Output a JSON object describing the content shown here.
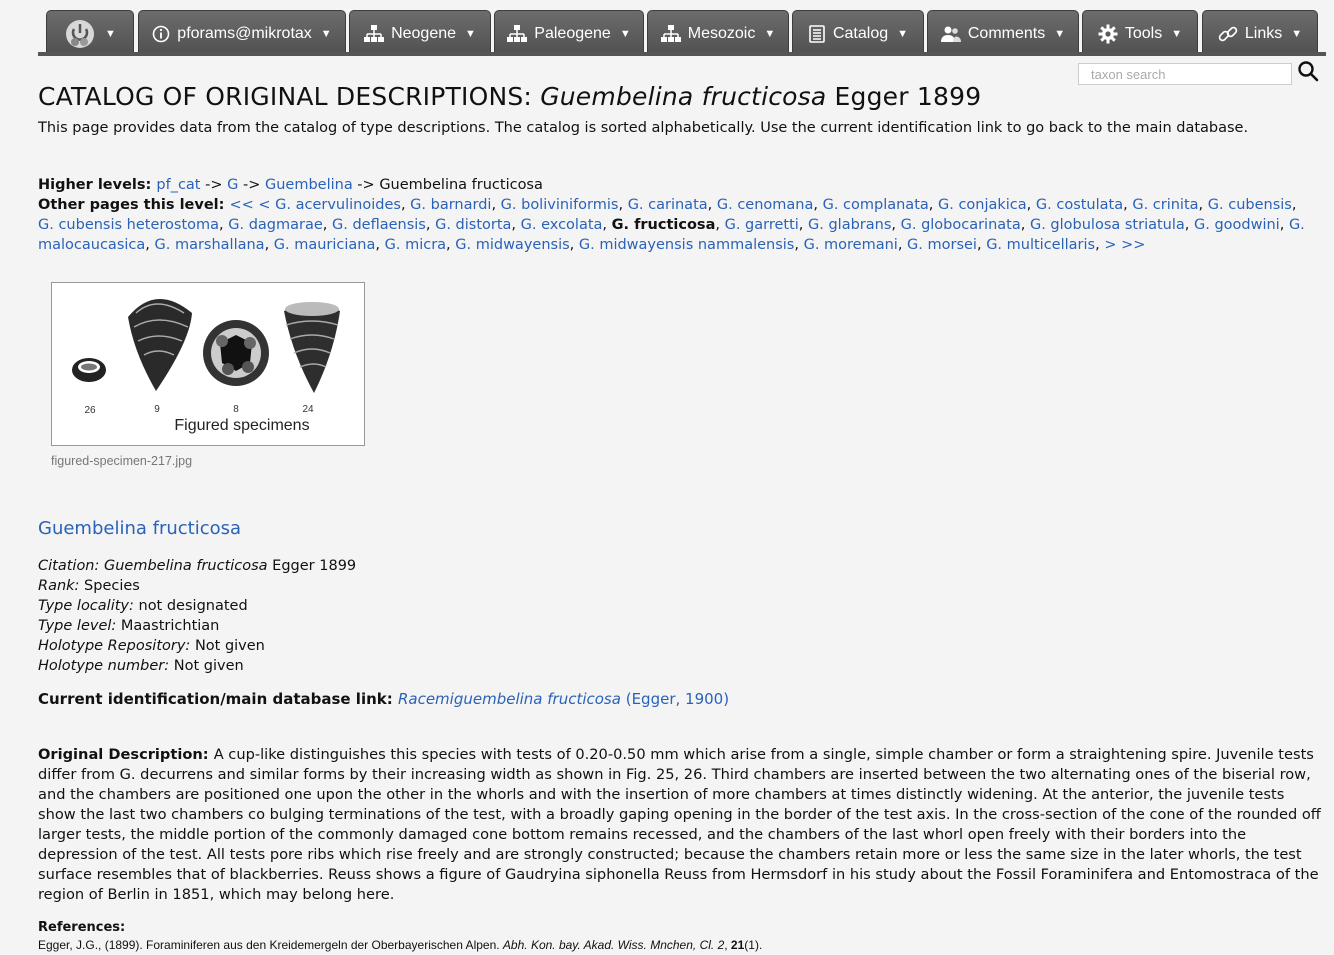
{
  "nav": {
    "tabs": [
      {
        "label": "",
        "icon": "logo-icon"
      },
      {
        "label": "pforams@mikrotax",
        "icon": "info-icon"
      },
      {
        "label": "Neogene",
        "icon": "hierarchy-icon"
      },
      {
        "label": "Paleogene",
        "icon": "hierarchy-icon"
      },
      {
        "label": "Mesozoic",
        "icon": "hierarchy-icon"
      },
      {
        "label": "Catalog",
        "icon": "book-icon"
      },
      {
        "label": "Comments",
        "icon": "users-icon"
      },
      {
        "label": "Tools",
        "icon": "gear-icon"
      },
      {
        "label": "Links",
        "icon": "link-icon"
      }
    ]
  },
  "search": {
    "placeholder": "taxon search"
  },
  "page": {
    "title_prefix": "CATALOG OF ORIGINAL DESCRIPTIONS: ",
    "title_taxon": "Guembelina fructicosa",
    "title_author": " Egger 1899",
    "intro": "This page provides data from the catalog of type descriptions. The catalog is sorted alphabetically. Use the current identification link to go back to the main database."
  },
  "higher_levels": {
    "label": "Higher levels: ",
    "path": [
      "pf_cat",
      "G",
      "Guembelina"
    ],
    "sep": " -> ",
    "current": "Guembelina fructicosa"
  },
  "other_pages": {
    "label": "Other pages this level: ",
    "prev": "<< <",
    "next": "> >>",
    "items": [
      "G. acervulinoides",
      "G. barnardi",
      "G. boliviniformis",
      "G. carinata",
      "G. cenomana",
      "G. complanata",
      "G. conjakica",
      "G. costulata",
      "G. crinita",
      "G. cubensis",
      "G. cubensis heterostoma",
      "G. dagmarae",
      "G. deflaensis",
      "G. distorta",
      "G. excolata",
      "G. fructicosa",
      "G. garretti",
      "G. glabrans",
      "G. globocarinata",
      "G. globulosa striatula",
      "G. goodwini",
      "G. malocaucasica",
      "G. marshallana",
      "G. mauriciana",
      "G. micra",
      "G. midwayensis",
      "G. midwayensis nammalensis",
      "G. moremani",
      "G. morsei",
      "G. multicellaris"
    ],
    "current": "G. fructicosa"
  },
  "figure": {
    "numbers": [
      "26",
      "9",
      "8",
      "24"
    ],
    "label": "Figured specimens",
    "caption": "figured-specimen-217.jpg"
  },
  "species": {
    "name": "Guembelina fructicosa",
    "citation_label": "Citation: ",
    "citation_taxon": "Guembelina fructicosa",
    "citation_author": " Egger 1899",
    "rank_label": "Rank: ",
    "rank": "Species",
    "locality_label": "Type locality: ",
    "locality": "not designated",
    "level_label": "Type level: ",
    "level": "Maastrichtian",
    "repo_label": "Holotype Repository: ",
    "repo": "Not given",
    "number_label": "Holotype number: ",
    "number": "Not given"
  },
  "current_id": {
    "label": "Current identification/main database link: ",
    "taxon": "Racemiguembelina fructicosa",
    "author": " (Egger, 1900)"
  },
  "description": {
    "label": "Original Description: ",
    "text": "A cup-like distinguishes this species with tests of 0.20-0.50 mm which arise from a single, simple chamber or form a straightening spire. Juvenile tests differ from G. decurrens and similar forms by their increasing width as shown in Fig. 25, 26. Third chambers are inserted between the two alternating ones of the biserial row, and the chambers are positioned one upon the other in the whorls and with the insertion of more chambers at times distinctly widening. At the anterior, the juvenile tests show the last two chambers co bulging terminations of the test, with a broadly gaping opening in the border of the test axis. In the cross-section of the cone of the rounded off larger tests, the middle portion of the commonly damaged cone bottom remains recessed, and the chambers of the last whorl open freely with their borders into the depression of the test. All tests pore ribs which rise freely and are strongly constructed; because the chambers retain more or less the same size in the later whorls, the test surface resembles that of blackberries. Reuss shows a figure of Gaudryina siphonella Reuss from Hermsdorf in his study about the Fossil Foraminifera and Entomostraca of the region of Berlin in 1851, which may belong here."
  },
  "references": {
    "heading": "References:",
    "items": [
      {
        "authors": "Egger, J.G., (1899). Foraminiferen aus den Kreidemergeln der Oberbayerischen Alpen. ",
        "journal": "Abh. Kon. bay. Akad. Wiss. Mnchen, Cl. 2",
        "volume": "21",
        "issue": "(1)."
      }
    ]
  },
  "colors": {
    "link": "#2a62b8",
    "nav_bg": "#5e5e5e",
    "page_bg": "#f4f4f4"
  }
}
